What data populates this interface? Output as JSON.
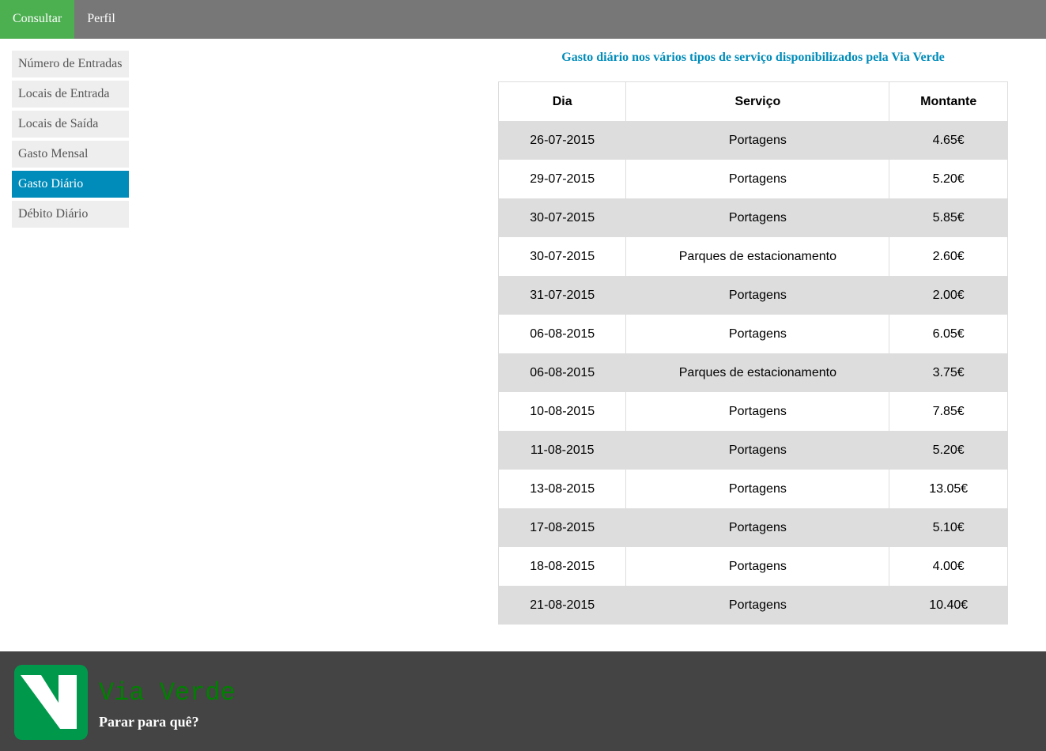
{
  "topnav": {
    "tabs": [
      {
        "label": "Consultar",
        "active": true
      },
      {
        "label": "Perfil",
        "active": false
      }
    ]
  },
  "sidebar": {
    "items": [
      {
        "label": "Número de Entradas",
        "active": false
      },
      {
        "label": "Locais de Entrada",
        "active": false
      },
      {
        "label": "Locais de Saída",
        "active": false
      },
      {
        "label": "Gasto Mensal",
        "active": false
      },
      {
        "label": "Gasto Diário",
        "active": true
      },
      {
        "label": "Débito Diário",
        "active": false
      }
    ]
  },
  "main": {
    "title": "Gasto diário nos vários tipos de serviço disponibilizados pela Via Verde",
    "table": {
      "headers": [
        "Dia",
        "Serviço",
        "Montante"
      ],
      "rows": [
        [
          "26-07-2015",
          "Portagens",
          "4.65€"
        ],
        [
          "29-07-2015",
          "Portagens",
          "5.20€"
        ],
        [
          "30-07-2015",
          "Portagens",
          "5.85€"
        ],
        [
          "30-07-2015",
          "Parques de estacionamento",
          "2.60€"
        ],
        [
          "31-07-2015",
          "Portagens",
          "2.00€"
        ],
        [
          "06-08-2015",
          "Portagens",
          "6.05€"
        ],
        [
          "06-08-2015",
          "Parques de estacionamento",
          "3.75€"
        ],
        [
          "10-08-2015",
          "Portagens",
          "7.85€"
        ],
        [
          "11-08-2015",
          "Portagens",
          "5.20€"
        ],
        [
          "13-08-2015",
          "Portagens",
          "13.05€"
        ],
        [
          "17-08-2015",
          "Portagens",
          "5.10€"
        ],
        [
          "18-08-2015",
          "Portagens",
          "4.00€"
        ],
        [
          "21-08-2015",
          "Portagens",
          "10.40€"
        ]
      ]
    }
  },
  "footer": {
    "logo_icon": "via-verde-logo",
    "brand": "Via Verde",
    "slogan": "Parar para quê?"
  },
  "colors": {
    "topnav_bg": "#777777",
    "active_tab": "#4CAF50",
    "sidebar_active": "#008CBA",
    "title": "#008CBA",
    "footer_bg": "#444444",
    "brand_text": "#008000",
    "logo_green": "#00994C"
  }
}
